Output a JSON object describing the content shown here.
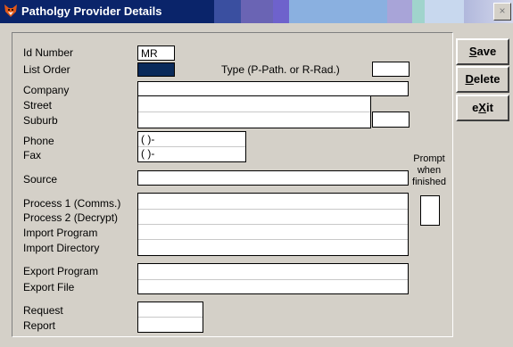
{
  "window": {
    "title": "Patholgy Provider Details",
    "close_glyph": "×",
    "icon": "fox-app-icon"
  },
  "fields": {
    "id_number": {
      "label": "Id Number",
      "value": "MR"
    },
    "list_order": {
      "label": "List Order",
      "value": ""
    },
    "type": {
      "label": "Type (P-Path. or R-Rad.)",
      "value": ""
    },
    "company": {
      "label": "Company",
      "value": ""
    },
    "street": {
      "label": "Street",
      "value": ""
    },
    "suburb": {
      "label": "Suburb",
      "value": ""
    },
    "postcode": {
      "value": ""
    },
    "phone": {
      "label": "Phone",
      "value": "( )-"
    },
    "fax": {
      "label": "Fax",
      "value": "( )-"
    },
    "source": {
      "label": "Source",
      "value": ""
    },
    "process1": {
      "label": "Process 1 (Comms.)",
      "value": ""
    },
    "process2": {
      "label": "Process 2 (Decrypt)",
      "value": ""
    },
    "import_program": {
      "label": "Import Program",
      "value": ""
    },
    "import_directory": {
      "label": "Import Directory",
      "value": ""
    },
    "export_program": {
      "label": "Export Program",
      "value": ""
    },
    "export_file": {
      "label": "Export File",
      "value": ""
    },
    "request": {
      "label": "Request",
      "value": ""
    },
    "report": {
      "label": "Report",
      "value": ""
    },
    "prompt_when_finished": {
      "label_lines": [
        "Prompt",
        "when",
        "finished"
      ],
      "value": ""
    }
  },
  "buttons": {
    "save": {
      "pre": "",
      "key": "S",
      "post": "ave"
    },
    "delete": {
      "pre": "",
      "key": "D",
      "post": "elete"
    },
    "exit": {
      "pre": "e",
      "key": "X",
      "post": "it"
    }
  },
  "colors": {
    "form_bg": "#d4d0c8",
    "list_order_fill": "#0a2a5a",
    "titlebar_dark": "#0a246a"
  }
}
